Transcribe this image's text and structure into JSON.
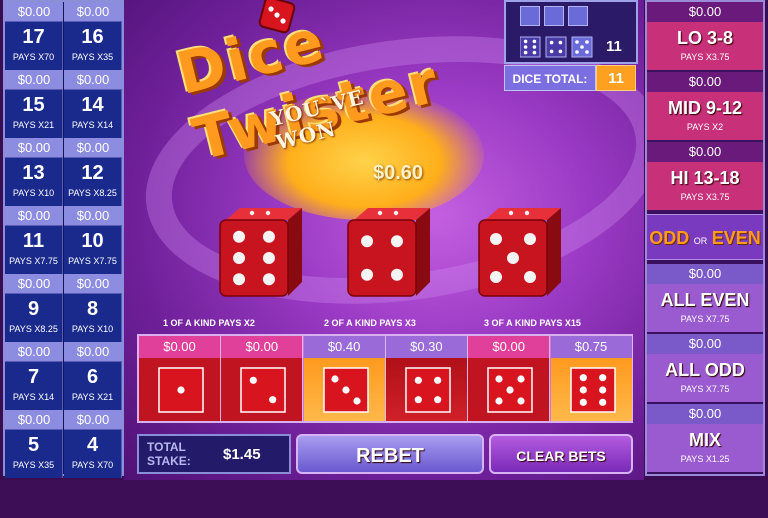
{
  "title": "Dice Twister",
  "message": "YOU`VE WON",
  "win_amount": "$0.60",
  "left_table": [
    {
      "a_amt": "$0.00",
      "a_num": "17",
      "a_pays": "PAYS X70",
      "b_amt": "$0.00",
      "b_num": "16",
      "b_pays": "PAYS X35"
    },
    {
      "a_amt": "$0.00",
      "a_num": "15",
      "a_pays": "PAYS X21",
      "b_amt": "$0.00",
      "b_num": "14",
      "b_pays": "PAYS X14"
    },
    {
      "a_amt": "$0.00",
      "a_num": "13",
      "a_pays": "PAYS X10",
      "b_amt": "$0.00",
      "b_num": "12",
      "b_pays": "PAYS X8.25"
    },
    {
      "a_amt": "$0.00",
      "a_num": "11",
      "a_pays": "PAYS X7.75",
      "b_amt": "$0.00",
      "b_num": "10",
      "b_pays": "PAYS X7.75"
    },
    {
      "a_amt": "$0.00",
      "a_num": "9",
      "a_pays": "PAYS X8.25",
      "b_amt": "$0.00",
      "b_num": "8",
      "b_pays": "PAYS X10"
    },
    {
      "a_amt": "$0.00",
      "a_num": "7",
      "a_pays": "PAYS X14",
      "b_amt": "$0.00",
      "b_num": "6",
      "b_pays": "PAYS X21"
    },
    {
      "a_amt": "$0.00",
      "a_num": "5",
      "a_pays": "PAYS X35",
      "b_amt": "$0.00",
      "b_num": "4",
      "b_pays": "PAYS X70"
    }
  ],
  "recent_total": "11",
  "dice_total_label": "DICE TOTAL:",
  "dice_total_value": "11",
  "dice_result": [
    6,
    4,
    5
  ],
  "right_bets": [
    {
      "amt": "$0.00",
      "name": "LO 3-8",
      "pays": "PAYS X3.75",
      "color": "#c8307a"
    },
    {
      "amt": "$0.00",
      "name": "MID 9-12",
      "pays": "PAYS X2",
      "color": "#c8307a"
    },
    {
      "amt": "$0.00",
      "name": "HI 13-18",
      "pays": "PAYS X3.75",
      "color": "#c8307a"
    },
    {
      "amt": "$0.00",
      "name": "ALL EVEN",
      "pays": "PAYS X7.75",
      "color": "#9a5ad0"
    },
    {
      "amt": "$0.00",
      "name": "ALL ODD",
      "pays": "PAYS X7.75",
      "color": "#9a5ad0"
    },
    {
      "amt": "$0.00",
      "name": "MIX",
      "pays": "PAYS X1.25",
      "color": "#9a5ad0"
    }
  ],
  "odd_even": {
    "odd": "ODD",
    "or": "OR",
    "even": "EVEN"
  },
  "kind_labels": [
    "1 OF A KIND PAYS X2",
    "2 OF A KIND PAYS X3",
    "3 OF A KIND PAYS X15"
  ],
  "kind_bets": [
    {
      "amt": "$0.00",
      "face": 1,
      "highlight": false
    },
    {
      "amt": "$0.00",
      "face": 2,
      "highlight": false
    },
    {
      "amt": "$0.40",
      "face": 3,
      "highlight": true
    },
    {
      "amt": "$0.30",
      "face": 4,
      "highlight": true
    },
    {
      "amt": "$0.00",
      "face": 5,
      "highlight": false
    },
    {
      "amt": "$0.75",
      "face": 6,
      "highlight": true
    }
  ],
  "stake_label": "TOTAL STAKE:",
  "stake_value": "$1.45",
  "rebet_label": "REBET",
  "clear_label": "CLEAR BETS",
  "colors": {
    "orange": "#ffa020",
    "die_red": "#c8141e",
    "panel_blue": "#1a2a8c"
  }
}
